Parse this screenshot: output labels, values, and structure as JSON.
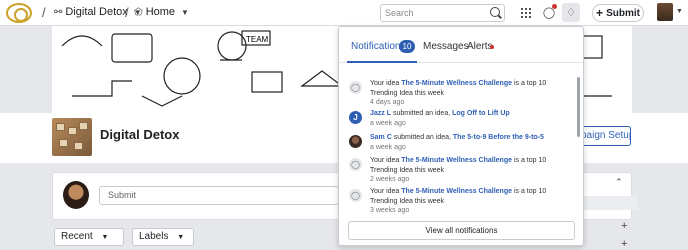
{
  "topbar": {
    "workspace": "Digital Detox",
    "home": "Home",
    "search_placeholder": "Search",
    "submit_label": "Submit"
  },
  "page": {
    "title": "Digital Detox",
    "campaign_button": "paign Setup",
    "submit_placeholder": "Submit",
    "sort_label": "Recent",
    "labels_label": "Labels"
  },
  "notifications": {
    "tabs": [
      "Notifications",
      "Messages",
      "Alerts"
    ],
    "count": "10",
    "items": [
      {
        "pre": "Your idea ",
        "link": "The 5-Minute Wellness Challenge",
        "post": " is a top 10 Trending Idea this week",
        "time": "4 days ago",
        "icon": "lightbulb-icon"
      },
      {
        "actor": "Jazz L",
        "pre": " submitted an idea, ",
        "link": "Log Off to Lift Up",
        "post": "",
        "time": "a week ago",
        "icon": "J"
      },
      {
        "actor": "Sam C",
        "pre": " submitted an idea, ",
        "link": "The 5-to-9 Before the 9-to-5",
        "post": "",
        "time": "a week ago",
        "icon": "photo"
      },
      {
        "pre": "Your idea ",
        "link": "The 5-Minute Wellness Challenge",
        "post": " is a top 10 Trending Idea this week",
        "time": "2 weeks ago",
        "icon": "lightbulb-icon"
      },
      {
        "pre": "Your idea ",
        "link": "The 5-Minute Wellness Challenge",
        "post": " is a top 10 Trending Idea this week",
        "time": "3 weeks ago",
        "icon": "lightbulb-icon"
      }
    ],
    "view_all": "View all notifications"
  },
  "colors": {
    "accent": "#2f5fb3",
    "alert": "#d0322f",
    "logo": "#c9a227"
  }
}
